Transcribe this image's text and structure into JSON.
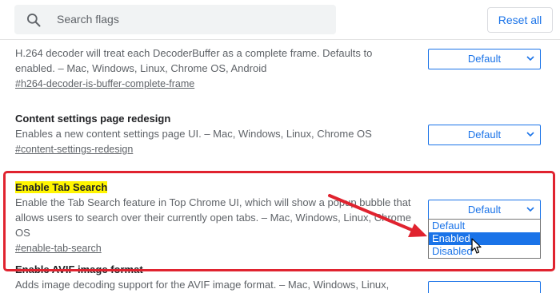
{
  "search": {
    "placeholder": "Search flags"
  },
  "toolbar": {
    "reset_label": "Reset all"
  },
  "flags": [
    {
      "title": "",
      "description": "H.264 decoder will treat each DecoderBuffer as a complete frame. Defaults to enabled. – Mac, Windows, Linux, Chrome OS, Android",
      "anchor": "#h264-decoder-is-buffer-complete-frame",
      "select_value": "Default"
    },
    {
      "title": "Content settings page redesign",
      "description": "Enables a new content settings page UI. – Mac, Windows, Linux, Chrome OS",
      "anchor": "#content-settings-redesign",
      "select_value": "Default"
    },
    {
      "title": "Enable Tab Search",
      "description": "Enable the Tab Search feature in Top Chrome UI, which will show a popup bubble that allows users to search over their currently open tabs. – Mac, Windows, Linux, Chrome OS",
      "anchor": "#enable-tab-search",
      "select_value": "Default",
      "dropdown_options": [
        "Default",
        "Enabled",
        "Disabled"
      ],
      "highlighted_option": "Enabled"
    },
    {
      "title": "Enable AVIF image format",
      "description": "Adds image decoding support for the AVIF image format. – Mac, Windows, Linux, Chrome",
      "anchor": "",
      "select_value": ""
    }
  ],
  "colors": {
    "accent": "#1a73e8",
    "annotation_red": "#e0232f",
    "highlight_yellow": "#fff500"
  },
  "icons": [
    "search-icon",
    "chevron-down-icon",
    "annotation-arrow",
    "mouse-cursor-icon"
  ]
}
